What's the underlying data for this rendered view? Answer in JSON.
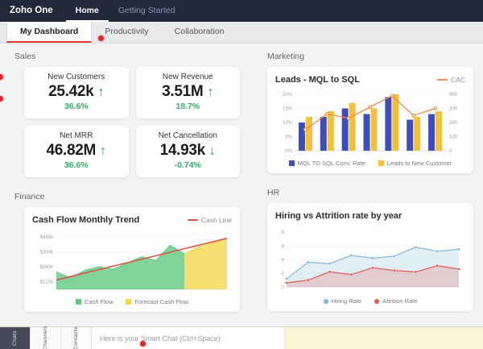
{
  "topbar": {
    "brand": "Zoho One",
    "nav": [
      {
        "label": "Home"
      },
      {
        "label": "Getting Started"
      }
    ]
  },
  "tabs": [
    {
      "label": "My Dashboard"
    },
    {
      "label": "Productivity"
    },
    {
      "label": "Collaboration"
    }
  ],
  "sales": {
    "label": "Sales",
    "kpis": [
      {
        "title": "New Customers",
        "value": "25.42k",
        "arrow": "↑",
        "delta": "36.6%"
      },
      {
        "title": "New Revenue",
        "value": "3.51M",
        "arrow": "↑",
        "delta": "18.7%"
      },
      {
        "title": "Net MRR",
        "value": "46.82M",
        "arrow": "↑",
        "delta": "36.6%"
      },
      {
        "title": "Net Cancellation",
        "value": "14.93k",
        "arrow": "↓",
        "delta": "-0.74%"
      }
    ]
  },
  "marketing": {
    "label": "Marketing"
  },
  "finance": {
    "label": "Finance"
  },
  "hr": {
    "label": "HR"
  },
  "chart_data": [
    {
      "type": "bar+line",
      "title": "Leads - MQL to SQL",
      "x": [
        1,
        2,
        3,
        4,
        5,
        6,
        7
      ],
      "series": [
        {
          "name": "MQL TO SQL Conv. Rate",
          "type": "bar",
          "axis": "left",
          "color": "#3d4eb8",
          "values": [
            10,
            12,
            15,
            13,
            19,
            11,
            13
          ]
        },
        {
          "name": "Leads to New Customer",
          "type": "bar",
          "axis": "left",
          "color": "#f3c03c",
          "values": [
            12,
            14,
            17,
            15,
            20,
            12,
            14
          ]
        },
        {
          "name": "CAC",
          "type": "line",
          "axis": "right",
          "color": "#f08c3e",
          "values": [
            150,
            260,
            230,
            310,
            390,
            250,
            300
          ]
        }
      ],
      "left_axis": {
        "min": 0,
        "max": 20,
        "ticks": [
          {
            "label": "0%",
            "value": 0
          },
          {
            "label": "5%",
            "value": 5
          },
          {
            "label": "10%",
            "value": 10
          },
          {
            "label": "15%",
            "value": 15
          },
          {
            "label": "20%",
            "value": 20
          }
        ]
      },
      "right_axis": {
        "min": 0,
        "max": 400,
        "ticks": [
          {
            "label": "0",
            "value": 0
          },
          {
            "label": "100",
            "value": 100
          },
          {
            "label": "200",
            "value": 200
          },
          {
            "label": "300",
            "value": 300
          },
          {
            "label": "400",
            "value": 400
          }
        ]
      },
      "legend_position": "bottom"
    },
    {
      "type": "area",
      "title": "Cash Flow Monthly Trend",
      "x_count": 13,
      "y_axis": {
        "min": 60,
        "max": 500,
        "ticks": [
          {
            "label": "$120k",
            "value": 120
          },
          {
            "label": "$240k",
            "value": 240
          },
          {
            "label": "$360k",
            "value": 360
          },
          {
            "label": "$480k",
            "value": 480
          }
        ]
      },
      "series": [
        {
          "name": "Cash Flow",
          "color": "#62c87f",
          "x": [
            0,
            1,
            2,
            3,
            4,
            5,
            6,
            7,
            8,
            9
          ],
          "values": [
            200,
            152,
            212,
            242,
            222,
            272,
            322,
            292,
            415,
            345
          ]
        },
        {
          "name": "Forecast Cash Flow",
          "color": "#f2d74e",
          "x": [
            9,
            10,
            11,
            12
          ],
          "values": [
            345,
            400,
            435,
            468
          ]
        }
      ],
      "trend": {
        "name": "Cash Line",
        "color": "#e4493d",
        "x": [
          0,
          12
        ],
        "values": [
          135,
          470
        ]
      },
      "legend_position": "bottom"
    },
    {
      "type": "line",
      "title": "Hiring vs Attrition rate by year",
      "x": [
        1,
        2,
        3,
        4,
        5,
        6,
        7,
        8,
        9
      ],
      "y_axis": {
        "min": 0,
        "max": 8,
        "ticks": [
          {
            "label": "0",
            "value": 0
          },
          {
            "label": "2",
            "value": 2
          },
          {
            "label": "4",
            "value": 4
          },
          {
            "label": "6",
            "value": 6
          },
          {
            "label": "8",
            "value": 8
          }
        ]
      },
      "series": [
        {
          "name": "Hiring Rate",
          "color": "#7db8d6",
          "values": [
            1.2,
            3.6,
            3.4,
            4.6,
            4.2,
            4.5,
            5.8,
            5.2,
            5.5
          ]
        },
        {
          "name": "Attrition Rate",
          "color": "#e2574c",
          "values": [
            0.6,
            1.0,
            2.2,
            1.8,
            2.8,
            2.4,
            2.2,
            3.1,
            2.6
          ]
        }
      ],
      "legend_position": "bottom"
    }
  ],
  "chat_bar": {
    "tabs": [
      {
        "label": "Chats"
      },
      {
        "label": "Channels"
      },
      {
        "label": "Contacts"
      }
    ],
    "placeholder": "Here is your Smart Chat (Ctrl+Space)"
  },
  "colors": {
    "topbar_bg": "#23273a",
    "accent_red": "#e4382d",
    "kpi_green": "#13a45b",
    "chat_bar_bg": "#fbf5d6"
  }
}
